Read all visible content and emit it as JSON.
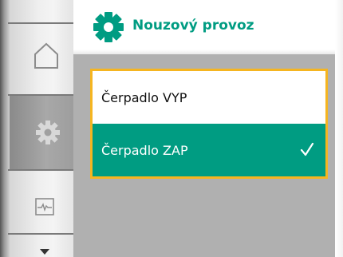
{
  "header": {
    "title": "Nouzový provoz",
    "icon": "gear-icon"
  },
  "nav_drum": {
    "items": [
      {
        "icon": "home-icon",
        "selected": false
      },
      {
        "icon": "gear-icon",
        "selected": true
      },
      {
        "icon": "pulse-chart-icon",
        "selected": false
      }
    ],
    "scroll_indicator": "chevron-down-icon"
  },
  "options": [
    {
      "label": "Čerpadlo VYP",
      "selected": false
    },
    {
      "label": "Čerpadlo ZAP",
      "selected": true
    }
  ],
  "colors": {
    "accent": "#009c82",
    "focus_border": "#f5b521",
    "background": "#b0b0b0",
    "selected_text": "#ffffff"
  }
}
